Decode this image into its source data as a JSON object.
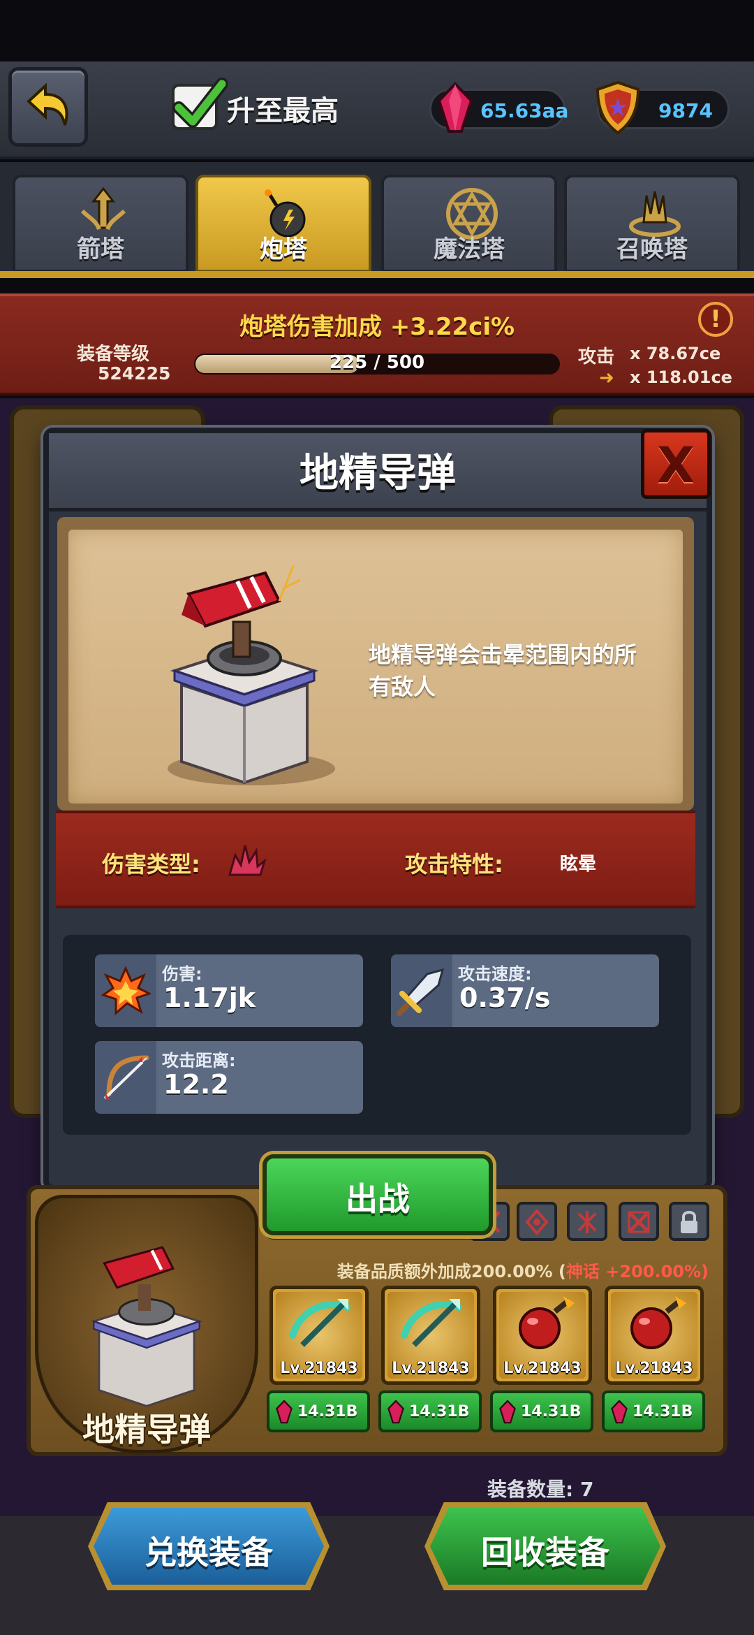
{
  "topbar": {
    "upgrade_label": "升至最高",
    "gems": "65.63aa",
    "shields": "9874"
  },
  "tabs": [
    {
      "label": "箭塔",
      "icon": "arrow-tower-icon",
      "active": false
    },
    {
      "label": "炮塔",
      "icon": "bomb-icon",
      "active": true
    },
    {
      "label": "魔法塔",
      "icon": "hexagram-icon",
      "active": false
    },
    {
      "label": "召唤塔",
      "icon": "summon-crown-icon",
      "active": false
    }
  ],
  "banner": {
    "bonus": "炮塔伤害加成 +3.22ci%",
    "equip_level_label": "装备等级",
    "equip_level_value": "524225",
    "progress_text": "225 / 500",
    "progress_fraction": 0.45,
    "attack_label": "攻击",
    "attack_value": "x 78.67ce",
    "attack_new": "x 118.01ce"
  },
  "modal": {
    "title": "地精导弹",
    "description": "地精导弹会击晕范围内的所有敌人",
    "damage_type_label": "伤害类型:",
    "attack_trait_label": "攻击特性:",
    "attack_trait_value": "眩晕",
    "stats": {
      "damage": {
        "label": "伤害:",
        "value": "1.17jk"
      },
      "speed": {
        "label": "攻击速度:",
        "value": "0.37/s"
      },
      "range": {
        "label": "攻击距离:",
        "value": "12.2"
      }
    },
    "deploy_label": "出战"
  },
  "equipment": {
    "tower_name": "地精导弹",
    "quality_bonus_prefix": "装备品质额外加成200.00% (",
    "quality_bonus_highlight": "神话 +200.00%",
    "quality_bonus_suffix": ")",
    "items": [
      {
        "level": "Lv.21843",
        "price": "14.31B",
        "icon": "green-crossbow-icon"
      },
      {
        "level": "Lv.21843",
        "price": "14.31B",
        "icon": "green-crossbow-icon"
      },
      {
        "level": "Lv.21843",
        "price": "14.31B",
        "icon": "red-bomb-icon"
      },
      {
        "level": "Lv.21843",
        "price": "14.31B",
        "icon": "red-bomb-icon"
      }
    ],
    "count_label": "装备数量: 7"
  },
  "buttons": {
    "exchange": "兑换装备",
    "recycle": "回收装备"
  },
  "colors": {
    "gem_text": "#59c4ff",
    "active_tab": "#f0c84a",
    "banner": "#8a2a1f",
    "highlight_yellow": "#ffd94a"
  }
}
